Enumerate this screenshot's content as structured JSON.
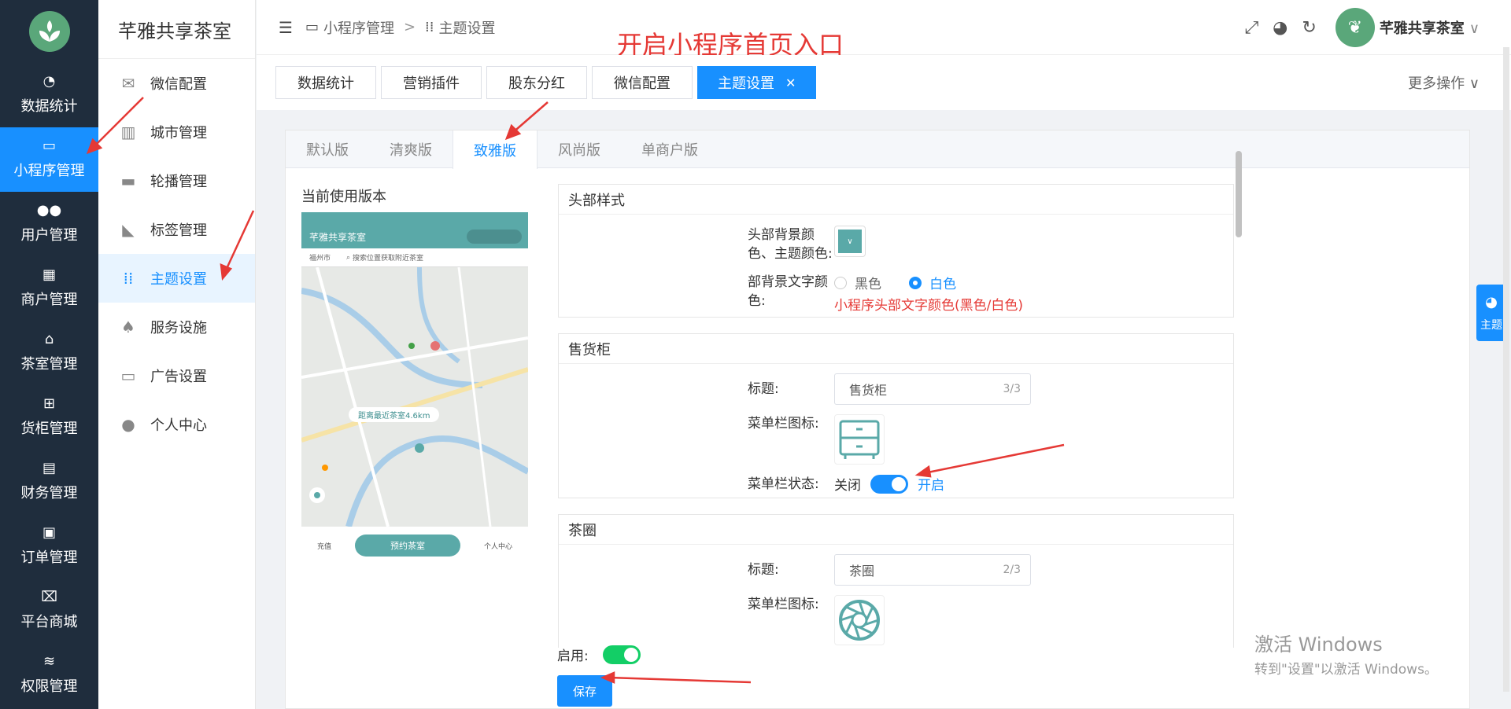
{
  "brand": {
    "name": "芊雅共享茶室"
  },
  "nav1": {
    "items": [
      {
        "icon": "dashboard-icon",
        "glyph": "◔",
        "label": "数据统计"
      },
      {
        "icon": "monitor-icon",
        "glyph": "▭",
        "label": "小程序管理"
      },
      {
        "icon": "users-icon",
        "glyph": "●●",
        "label": "用户管理"
      },
      {
        "icon": "building-icon",
        "glyph": "▦",
        "label": "商户管理"
      },
      {
        "icon": "home-icon",
        "glyph": "⌂",
        "label": "茶室管理"
      },
      {
        "icon": "grid-icon",
        "glyph": "⊞",
        "label": "货柜管理"
      },
      {
        "icon": "wallet-icon",
        "glyph": "▤",
        "label": "财务管理"
      },
      {
        "icon": "clipboard-icon",
        "glyph": "▣",
        "label": "订单管理"
      },
      {
        "icon": "store-icon",
        "glyph": "⌧",
        "label": "平台商城"
      },
      {
        "icon": "database-icon",
        "glyph": "≋",
        "label": "权限管理"
      }
    ]
  },
  "nav2": {
    "title": "芊雅共享茶室",
    "items": [
      {
        "icon": "chat-icon",
        "glyph": "✉",
        "label": "微信配置"
      },
      {
        "icon": "city-icon",
        "glyph": "▥",
        "label": "城市管理"
      },
      {
        "icon": "carousel-icon",
        "glyph": "▬",
        "label": "轮播管理"
      },
      {
        "icon": "tag-icon",
        "glyph": "◣",
        "label": "标签管理"
      },
      {
        "icon": "apps-icon",
        "glyph": "⁞⁞",
        "label": "主题设置"
      },
      {
        "icon": "tree-icon",
        "glyph": "♠",
        "label": "服务设施"
      },
      {
        "icon": "ad-icon",
        "glyph": "▭",
        "label": "广告设置"
      },
      {
        "icon": "person-icon",
        "glyph": "●",
        "label": "个人中心"
      }
    ]
  },
  "header": {
    "breadcrumb": [
      "小程序管理",
      "主题设置"
    ],
    "annotation": "开启小程序首页入口",
    "user": "芊雅共享茶室"
  },
  "tags": {
    "items": [
      "数据统计",
      "营销插件",
      "股东分红",
      "微信配置",
      "主题设置"
    ],
    "more": "更多操作"
  },
  "versions": {
    "tabs": [
      "默认版",
      "清爽版",
      "致雅版",
      "风尚版",
      "单商户版"
    ],
    "current_label": "当前使用版本"
  },
  "phone": {
    "title": "芊雅共享茶室",
    "city": "福州市",
    "search": "搜索位置获取附近茶室",
    "distance": "距离最近茶室4.6km",
    "book": "预约茶室",
    "nav_left": "充值",
    "nav_right": "个人中心"
  },
  "header_style": {
    "title": "头部样式",
    "bg_label": "头部背景颜色、主题颜色:",
    "text_label": "部背景文字颜色:",
    "opt_black": "黑色",
    "opt_white": "白色",
    "hint": "小程序头部文字颜色(黑色/白色)"
  },
  "vending": {
    "title": "售货柜",
    "title_label": "标题:",
    "title_value": "售货柜",
    "count": "3/3",
    "icon_label": "菜单栏图标:",
    "status_label": "菜单栏状态:",
    "off": "关闭",
    "on": "开启"
  },
  "tea_circle": {
    "title": "茶圈",
    "title_label": "标题:",
    "title_value": "茶圈",
    "count": "2/3",
    "icon_label": "菜单栏图标:"
  },
  "footer": {
    "enable_label": "启用:",
    "save": "保存"
  },
  "watermark": {
    "line1": "激活 Windows",
    "line2": "转到\"设置\"以激活 Windows。"
  },
  "theme_float": {
    "label": "主题"
  },
  "colors": {
    "accent": "#1890ff",
    "nav_dark": "#1f2d3d",
    "annotation": "#e53935",
    "theme": "#5aa9a8"
  }
}
